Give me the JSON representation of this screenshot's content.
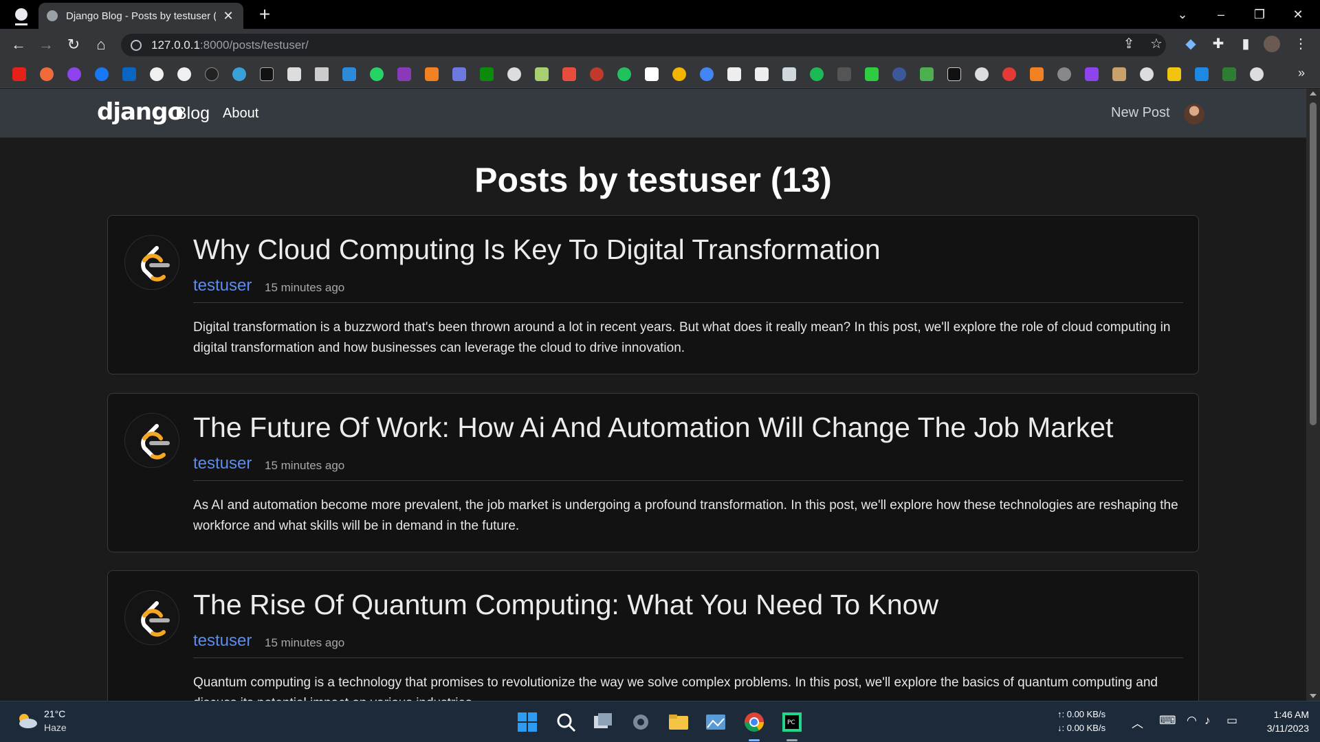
{
  "browser": {
    "tab_title": "Django Blog - Posts by testuser (",
    "tab_close": "✕",
    "new_tab": "+",
    "url_host": "127.0.0.1",
    "url_path": ":8000/posts/testuser/",
    "bookmarks_more": "»"
  },
  "navbar": {
    "brand": "django",
    "brand_sub": "Blog",
    "about": "About",
    "new_post": "New Post"
  },
  "page": {
    "title": "Posts by testuser (13)"
  },
  "posts": [
    {
      "title": "Why Cloud Computing Is Key To Digital Transformation",
      "author": "testuser",
      "time": "15 minutes ago",
      "body": "Digital transformation is a buzzword that's been thrown around a lot in recent years. But what does it really mean? In this post, we'll explore the role of cloud computing in digital transformation and how businesses can leverage the cloud to drive innovation."
    },
    {
      "title": "The Future Of Work: How Ai And Automation Will Change The Job Market",
      "author": "testuser",
      "time": "15 minutes ago",
      "body": "As AI and automation become more prevalent, the job market is undergoing a profound transformation. In this post, we'll explore how these technologies are reshaping the workforce and what skills will be in demand in the future."
    },
    {
      "title": "The Rise Of Quantum Computing: What You Need To Know",
      "author": "testuser",
      "time": "15 minutes ago",
      "body": "Quantum computing is a technology that promises to revolutionize the way we solve complex problems. In this post, we'll explore the basics of quantum computing and discuss its potential impact on various industries."
    }
  ],
  "taskbar": {
    "temperature": "21°C",
    "condition": "Haze",
    "upload": "↑: 0.00 KB/s",
    "download": "↓: 0.00 KB/s",
    "time": "1:46 AM",
    "date": "3/11/2023"
  },
  "colors": {
    "accent_link": "#5b8def",
    "navbar_bg": "#343a40",
    "page_bg": "#1b1b1b",
    "card_bg": "#121212"
  }
}
